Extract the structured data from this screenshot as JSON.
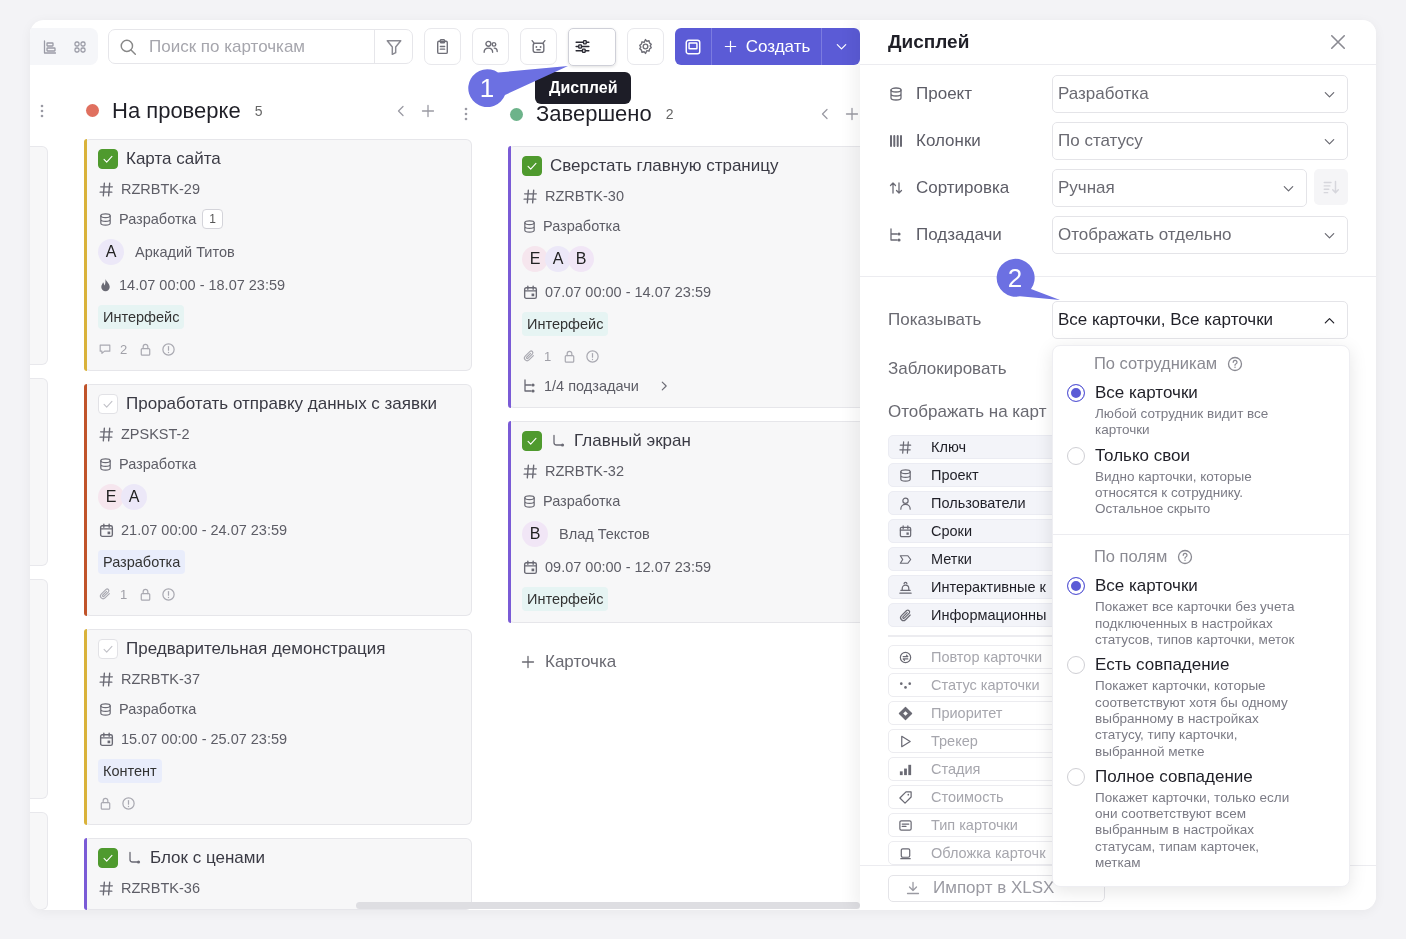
{
  "toolbar": {
    "search": {
      "placeholder": "Поиск по карточкам"
    },
    "icon_buttons": [
      {
        "selected": false
      },
      {
        "selected": false
      },
      {
        "selected": false
      },
      {
        "selected": true
      },
      {
        "selected": false
      }
    ],
    "create": {
      "label": "Создать"
    }
  },
  "tooltip": {
    "text": "Дисплей"
  },
  "callouts": [
    {
      "number": "1"
    },
    {
      "number": "2"
    }
  ],
  "columns": [
    {
      "title": "На проверке",
      "count": "5",
      "color": "#e0705f",
      "cards": [
        {
          "color": "#d9b23a",
          "done": true,
          "is_subtask": false,
          "title": "Карта сайта",
          "key": "RZRBTK-29",
          "project": "Разработка",
          "project_badge": "1",
          "avatars": [
            {
              "letter": "А",
              "color": "#ece8f8"
            }
          ],
          "assignee": "Аркадий Титов",
          "urgent": true,
          "dates": "14.07 00:00 - 18.07 23:59",
          "tag": {
            "text": "Интерфейс",
            "color": "#e6f4f3"
          },
          "footer": {
            "kind": "comments",
            "count": "2"
          }
        },
        {
          "color": "#c0532a",
          "done": false,
          "is_subtask": false,
          "title": "Проработать отправку данных с заявки",
          "key": "ZPSKST-2",
          "project": "Разработка",
          "avatars": [
            {
              "letter": "Е",
              "color": "#f6e6ee"
            },
            {
              "letter": "А",
              "color": "#ece8f8"
            }
          ],
          "urgent": false,
          "dates": "21.07 00:00 - 24.07 23:59",
          "tag": {
            "text": "Разработка",
            "color": "#e9edfb"
          },
          "footer": {
            "kind": "attachments",
            "count": "1"
          }
        },
        {
          "color": "#d9b23a",
          "done": false,
          "is_subtask": false,
          "title": "Предварительная демонстрация",
          "key": "RZRBTK-37",
          "project": "Разработка",
          "urgent": false,
          "dates": "15.07 00:00 - 25.07 23:59",
          "tag": {
            "text": "Контент",
            "color": "#e9edfb"
          },
          "footer": {
            "kind": "none"
          }
        },
        {
          "color": "#7a5bd6",
          "done": true,
          "is_subtask": true,
          "title": "Блок с ценами",
          "key": "RZRBTK-36"
        }
      ]
    },
    {
      "title": "Завершено",
      "count": "2",
      "color": "#6db38a",
      "add_label": "Карточка",
      "cards": [
        {
          "color": "#7a5bd6",
          "done": true,
          "is_subtask": false,
          "title": "Сверстать главную страницу",
          "key": "RZRBTK-30",
          "project": "Разработка",
          "avatars": [
            {
              "letter": "Е",
              "color": "#f6e6ee"
            },
            {
              "letter": "А",
              "color": "#ece8f8"
            },
            {
              "letter": "В",
              "color": "#f1e6f6"
            }
          ],
          "urgent": false,
          "dates": "07.07 00:00 - 14.07 23:59",
          "tag": {
            "text": "Интерфейс",
            "color": "#e6f4f3"
          },
          "footer": {
            "kind": "attachments",
            "count": "1"
          },
          "subtasks": "1/4 подзадачи"
        },
        {
          "color": "#7a5bd6",
          "done": true,
          "is_subtask": true,
          "title": "Главный экран",
          "key": "RZRBTK-32",
          "project": "Разработка",
          "avatars": [
            {
              "letter": "В",
              "color": "#f1e6f6"
            }
          ],
          "assignee": "Влад Текстов",
          "urgent": false,
          "dates": "09.07 00:00 - 12.07 23:59",
          "tag": {
            "text": "Интерфейс",
            "color": "#e6f4f3"
          }
        }
      ]
    }
  ],
  "panel": {
    "title": "Дисплей",
    "settings": [
      {
        "kind": "select",
        "label": "Проект",
        "value": "Разработка"
      },
      {
        "kind": "select",
        "label": "Колонки",
        "value": "По статусу"
      },
      {
        "kind": "select_with_button",
        "label": "Сортировка",
        "value": "Ручная",
        "button_disabled": true
      },
      {
        "kind": "select",
        "label": "Подзадачи",
        "value": "Отображать отдельно"
      }
    ],
    "show": {
      "label": "Показывать",
      "value": "Все карточки, Все карточки",
      "expanded": true
    },
    "lock": {
      "label": "Заблокировать"
    },
    "card_fields": {
      "label": "Отображать на карт",
      "items": [
        {
          "label": "Ключ",
          "enabled": true
        },
        {
          "label": "Проект",
          "enabled": true
        },
        {
          "label": "Пользователи",
          "enabled": true
        },
        {
          "label": "Сроки",
          "enabled": true
        },
        {
          "label": "Метки",
          "enabled": true
        },
        {
          "label": "Интерактивные к",
          "enabled": true
        },
        {
          "label": "Информационны",
          "enabled": true
        },
        {
          "label": "Повтор карточки",
          "enabled": false
        },
        {
          "label": "Статус карточки",
          "enabled": false
        },
        {
          "label": "Приоритет",
          "enabled": false
        },
        {
          "label": "Трекер",
          "enabled": false
        },
        {
          "label": "Стадия",
          "enabled": false
        },
        {
          "label": "Стоимость",
          "enabled": false
        },
        {
          "label": "Тип карточки",
          "enabled": false
        },
        {
          "label": "Обложка карточк",
          "enabled": false
        }
      ]
    },
    "import_label": "Импорт в XLSX",
    "dropdown": {
      "groups": [
        {
          "title": "По сотрудникам",
          "options": [
            {
              "label": "Все карточки",
              "description": "Любой сотрудник видит все карточки",
              "selected": true
            },
            {
              "label": "Только свои",
              "description": "Видно карточки, которые относятся к сотруднику. Остальное скрыто",
              "selected": false
            }
          ]
        },
        {
          "title": "По полям",
          "options": [
            {
              "label": "Все карточки",
              "description": "Покажет все карточки без учета подключенных в настройках статусов, типов карточки, меток",
              "selected": true
            },
            {
              "label": "Есть совпадение",
              "description": "Покажет карточки, которые соответствуют хотя бы одному выбранному в настройках статусу, типу карточки, выбранной метке",
              "selected": false
            },
            {
              "label": "Полное совпадение",
              "description": "Покажет карточки, только если они соответствуют всем выбранным в настройках статусам, типам карточек, меткам",
              "selected": false
            }
          ]
        }
      ]
    }
  }
}
